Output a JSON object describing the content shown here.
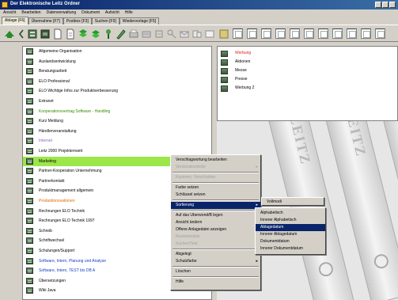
{
  "window": {
    "title": "Der Elektronische Leitz Ordner"
  },
  "menubar": {
    "items": [
      "Ansicht",
      "Bearbeiten",
      "Datenverwaltung",
      "Dokument",
      "Aufsicht",
      "Hilfe"
    ]
  },
  "tabs": [
    {
      "label": "Ablage [F6]",
      "active": true
    },
    {
      "label": "Übernahme [F7]",
      "active": false
    },
    {
      "label": "Postbox [F3]",
      "active": false
    },
    {
      "label": "Suchen [F9]",
      "active": false
    },
    {
      "label": "Wiedervorlage [F5]",
      "active": false
    }
  ],
  "left_tree": {
    "items": [
      {
        "label": "Allgemeine Organisation",
        "style": "normal"
      },
      {
        "label": "Auslandsentwicklung",
        "style": "normal"
      },
      {
        "label": "Beratungsarbeit",
        "style": "normal"
      },
      {
        "label": "ELO Professional",
        "style": "normal"
      },
      {
        "label": "ELO Wichtige Infos zur Produktverbesserung",
        "style": "normal"
      },
      {
        "label": "Extranet",
        "style": "normal"
      },
      {
        "label": "Kooperationsvertrag Software - Handling",
        "style": "green"
      },
      {
        "label": "Kurz Meldung",
        "style": "normal"
      },
      {
        "label": "Händlerveranstaltung",
        "style": "normal"
      },
      {
        "label": "Internet",
        "style": "violet"
      },
      {
        "label": "Leitz 2000 Projekterrweit",
        "style": "normal"
      },
      {
        "label": "Marketing",
        "style": "selected"
      },
      {
        "label": "Partner-Kooperation Unternehmung",
        "style": "normal"
      },
      {
        "label": "Partnerkontakt",
        "style": "normal"
      },
      {
        "label": "Produktmanagement allgemein",
        "style": "normal"
      },
      {
        "label": "Produktinnovationen",
        "style": "orange"
      },
      {
        "label": "Rechnungen ELO Technik",
        "style": "normal"
      },
      {
        "label": "Rechnungen ELO Technik 1997",
        "style": "normal"
      },
      {
        "label": "Schreib",
        "style": "normal"
      },
      {
        "label": "Schriftwechsel",
        "style": "normal"
      },
      {
        "label": "Schulungen/Support",
        "style": "normal"
      },
      {
        "label": "Software, Intern, Planung und Analyse",
        "style": "blue"
      },
      {
        "label": "Software, Intern, TEST bis DB A",
        "style": "blue"
      },
      {
        "label": "Übersetzungen",
        "style": "normal"
      },
      {
        "label": "Wiki Java",
        "style": "normal"
      }
    ]
  },
  "right_list": {
    "items": [
      {
        "label": "Werbung",
        "style": "red"
      },
      {
        "label": "Aktionen",
        "style": "normal"
      },
      {
        "label": "Messe",
        "style": "normal"
      },
      {
        "label": "Presse",
        "style": "normal"
      },
      {
        "label": "Werbung 2",
        "style": "normal"
      }
    ]
  },
  "binders": {
    "label": "LEITZ"
  },
  "context_menu": {
    "items": [
      {
        "label": "Verschlagwortung bearbeiten",
        "state": "normal"
      },
      {
        "label": "Versionskontrolle",
        "state": "disabled",
        "submenu": true
      },
      {
        "sep": true
      },
      {
        "label": "Kopieren, Verschieben",
        "state": "disabled"
      },
      {
        "sep": true
      },
      {
        "label": "Farbe setzen",
        "state": "normal"
      },
      {
        "label": "Schlüssel setzen",
        "state": "normal"
      },
      {
        "sep": true
      },
      {
        "label": "Sortierung",
        "state": "highlight",
        "submenu": true
      },
      {
        "sep": true
      },
      {
        "label": "Auf das Uberwond/B legen",
        "state": "normal"
      },
      {
        "label": "Ansicht ändern",
        "state": "normal"
      },
      {
        "label": "Offene Anlagedatei anzeigen",
        "state": "normal"
      },
      {
        "label": "Revisionsliste",
        "state": "disabled"
      },
      {
        "label": "Suchen/Text",
        "state": "disabled"
      },
      {
        "sep": true
      },
      {
        "label": "Abgelegt",
        "state": "normal",
        "submenu": true
      },
      {
        "label": "Schutzfarbe",
        "state": "normal",
        "submenu": true
      },
      {
        "sep": true
      },
      {
        "label": "Löschen",
        "state": "normal"
      },
      {
        "sep": true
      },
      {
        "label": "Hilfe",
        "state": "normal"
      }
    ]
  },
  "submenu_1": {
    "label": "Vollmodi"
  },
  "submenu_2": {
    "items": [
      {
        "label": "Alphabetisch",
        "state": "normal"
      },
      {
        "label": "Innerer Alphabetisch",
        "state": "normal"
      },
      {
        "label": "Ablagedatum",
        "state": "highlight"
      },
      {
        "label": "Innerer Ablagedatum",
        "state": "normal"
      },
      {
        "label": "Dokumentdatum",
        "state": "normal"
      },
      {
        "label": "Innerer Dokumentdatum",
        "state": "normal"
      }
    ]
  },
  "colors": {
    "selection_green": "#9ce64a",
    "menu_highlight": "#0a246a",
    "title_blue": "#0a246a"
  }
}
